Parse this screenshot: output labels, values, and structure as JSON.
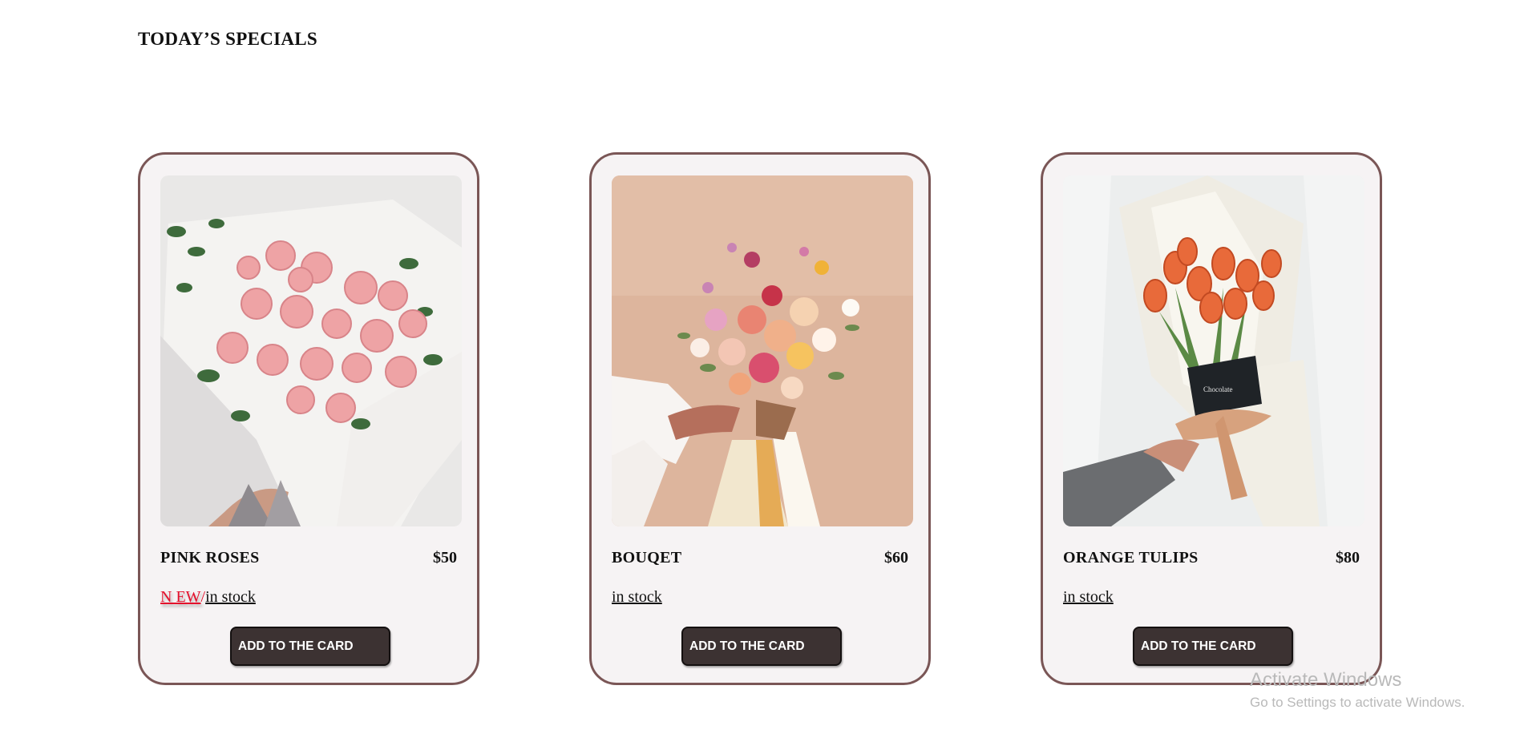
{
  "section": {
    "title": "TODAY’S SPECIALS"
  },
  "products": [
    {
      "name": "PINK ROSES",
      "price": "$50",
      "badge": "N EW",
      "separator": "/",
      "stock": "in stock",
      "button": "ADD TO THE CARD",
      "image": "pink-roses-bouquet-photo"
    },
    {
      "name": "BOUQET",
      "price": "$60",
      "stock": "in stock",
      "button": "ADD TO THE CARD",
      "image": "mixed-flower-bouquet-photo"
    },
    {
      "name": "ORANGE TULIPS",
      "price": "$80",
      "stock": "in stock",
      "button": "ADD TO THE CARD",
      "image": "orange-tulips-bouquet-photo"
    }
  ],
  "watermark": {
    "title": "Activate Windows",
    "subtitle": "Go to Settings to activate Windows."
  },
  "colors": {
    "card_border": "#7a5656",
    "card_bg": "#f6f3f4",
    "button_bg": "#3c3232",
    "new_badge": "#e4102c"
  }
}
